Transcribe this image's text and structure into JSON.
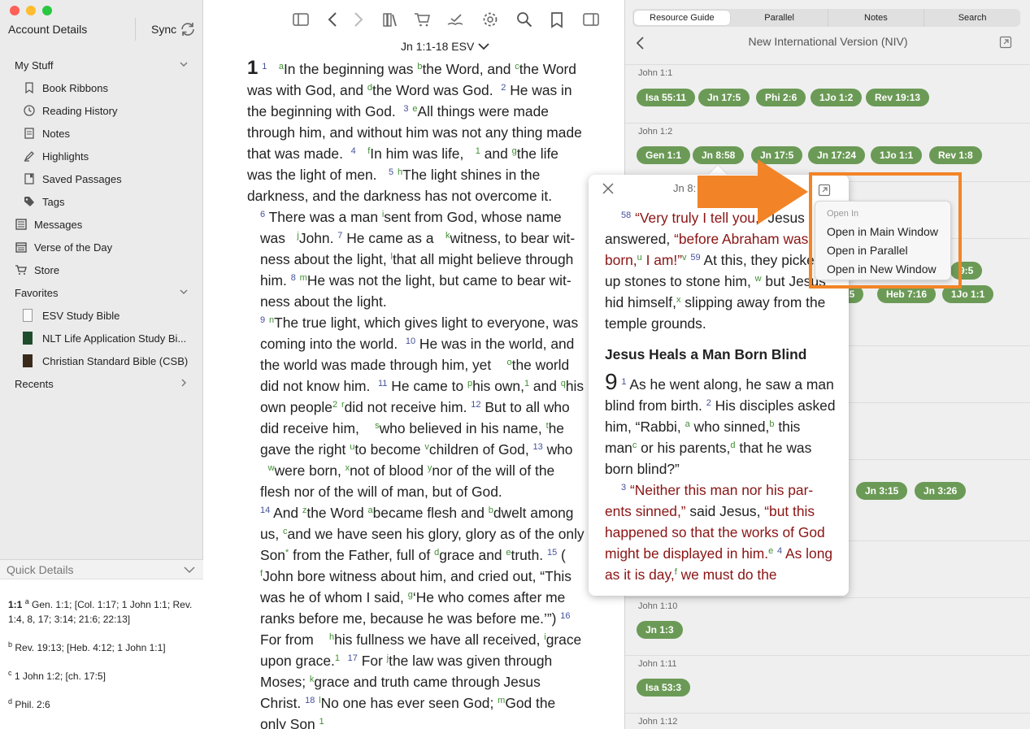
{
  "sidebar": {
    "title": "Account Details",
    "sync_label": "Sync",
    "my_stuff": {
      "label": "My Stuff",
      "items": [
        {
          "label": "Book Ribbons",
          "icon": "bookmark-icon"
        },
        {
          "label": "Reading History",
          "icon": "clock-icon"
        },
        {
          "label": "Notes",
          "icon": "note-icon"
        },
        {
          "label": "Highlights",
          "icon": "highlighter-icon"
        },
        {
          "label": "Saved Passages",
          "icon": "saved-passage-icon"
        },
        {
          "label": "Tags",
          "icon": "tag-icon"
        }
      ]
    },
    "top_items": [
      {
        "label": "Messages",
        "icon": "messages-icon"
      },
      {
        "label": "Verse of the Day",
        "icon": "calendar-icon"
      },
      {
        "label": "Store",
        "icon": "cart-icon"
      }
    ],
    "favorites": {
      "label": "Favorites",
      "items": [
        {
          "label": "ESV Study Bible"
        },
        {
          "label": "NLT Life Application Study Bi..."
        },
        {
          "label": "Christian Standard Bible (CSB)"
        }
      ]
    },
    "recents_label": "Recents"
  },
  "quick_details": {
    "title": "Quick Details",
    "entries": [
      {
        "ref": "1:1",
        "marker": "a",
        "text": "Gen. 1:1; [Col. 1:17; 1 John 1:1; Rev. 1:4, 8, 17; 3:14; 21:6; 22:13]"
      },
      {
        "ref": "",
        "marker": "b",
        "text": "Rev. 19:13; [Heb. 4:12; 1 John 1:1]"
      },
      {
        "ref": "",
        "marker": "c",
        "text": "1 John 1:2; [ch. 17:5]"
      },
      {
        "ref": "",
        "marker": "d",
        "text": "Phil. 2:6"
      }
    ]
  },
  "reader": {
    "reference": "Jn 1:1-18",
    "version": "ESV"
  },
  "resource_panel": {
    "tabs": [
      "Resource Guide",
      "Parallel",
      "Notes",
      "Search"
    ],
    "active_tab": "Resource Guide",
    "title": "New International Version (NIV)",
    "sections": [
      {
        "label": "John 1:1",
        "pills": [
          "Isa 55:11",
          "Jn 17:5",
          "Phi 2:6",
          "1Jo 1:2",
          "Rev 19:13"
        ]
      },
      {
        "label": "John 1:2",
        "pills": [
          "Gen 1:1",
          "Jn 8:58",
          "Jn 17:5",
          "Jn 17:24",
          "1Jo 1:1",
          "Rev 1:8"
        ]
      },
      {
        "label": "John 1:10",
        "pills": [
          "Jn 1:3"
        ]
      },
      {
        "label": "John 1:11",
        "pills": [
          "Isa 53:3"
        ]
      },
      {
        "label": "John 1:12",
        "pills": []
      }
    ],
    "partial_pills": [
      "9:5",
      "15",
      "Heb 7:16",
      "1Jo 1:1",
      "Jn 3:15",
      "Jn 3:26"
    ]
  },
  "popover": {
    "title": "Jn 8:",
    "section_heading": "Jesus Heals a Man Born Blind",
    "chapter": "9"
  },
  "open_in_menu": {
    "header": "Open In",
    "items": [
      "Open in Main Window",
      "Open in Parallel",
      "Open in New Window"
    ]
  },
  "colors": {
    "pill": "#6b9a56",
    "callout": "#f28427",
    "words_of_christ": "#8a1414",
    "verse_number": "#44519a",
    "footnote": "#3f8e32"
  }
}
